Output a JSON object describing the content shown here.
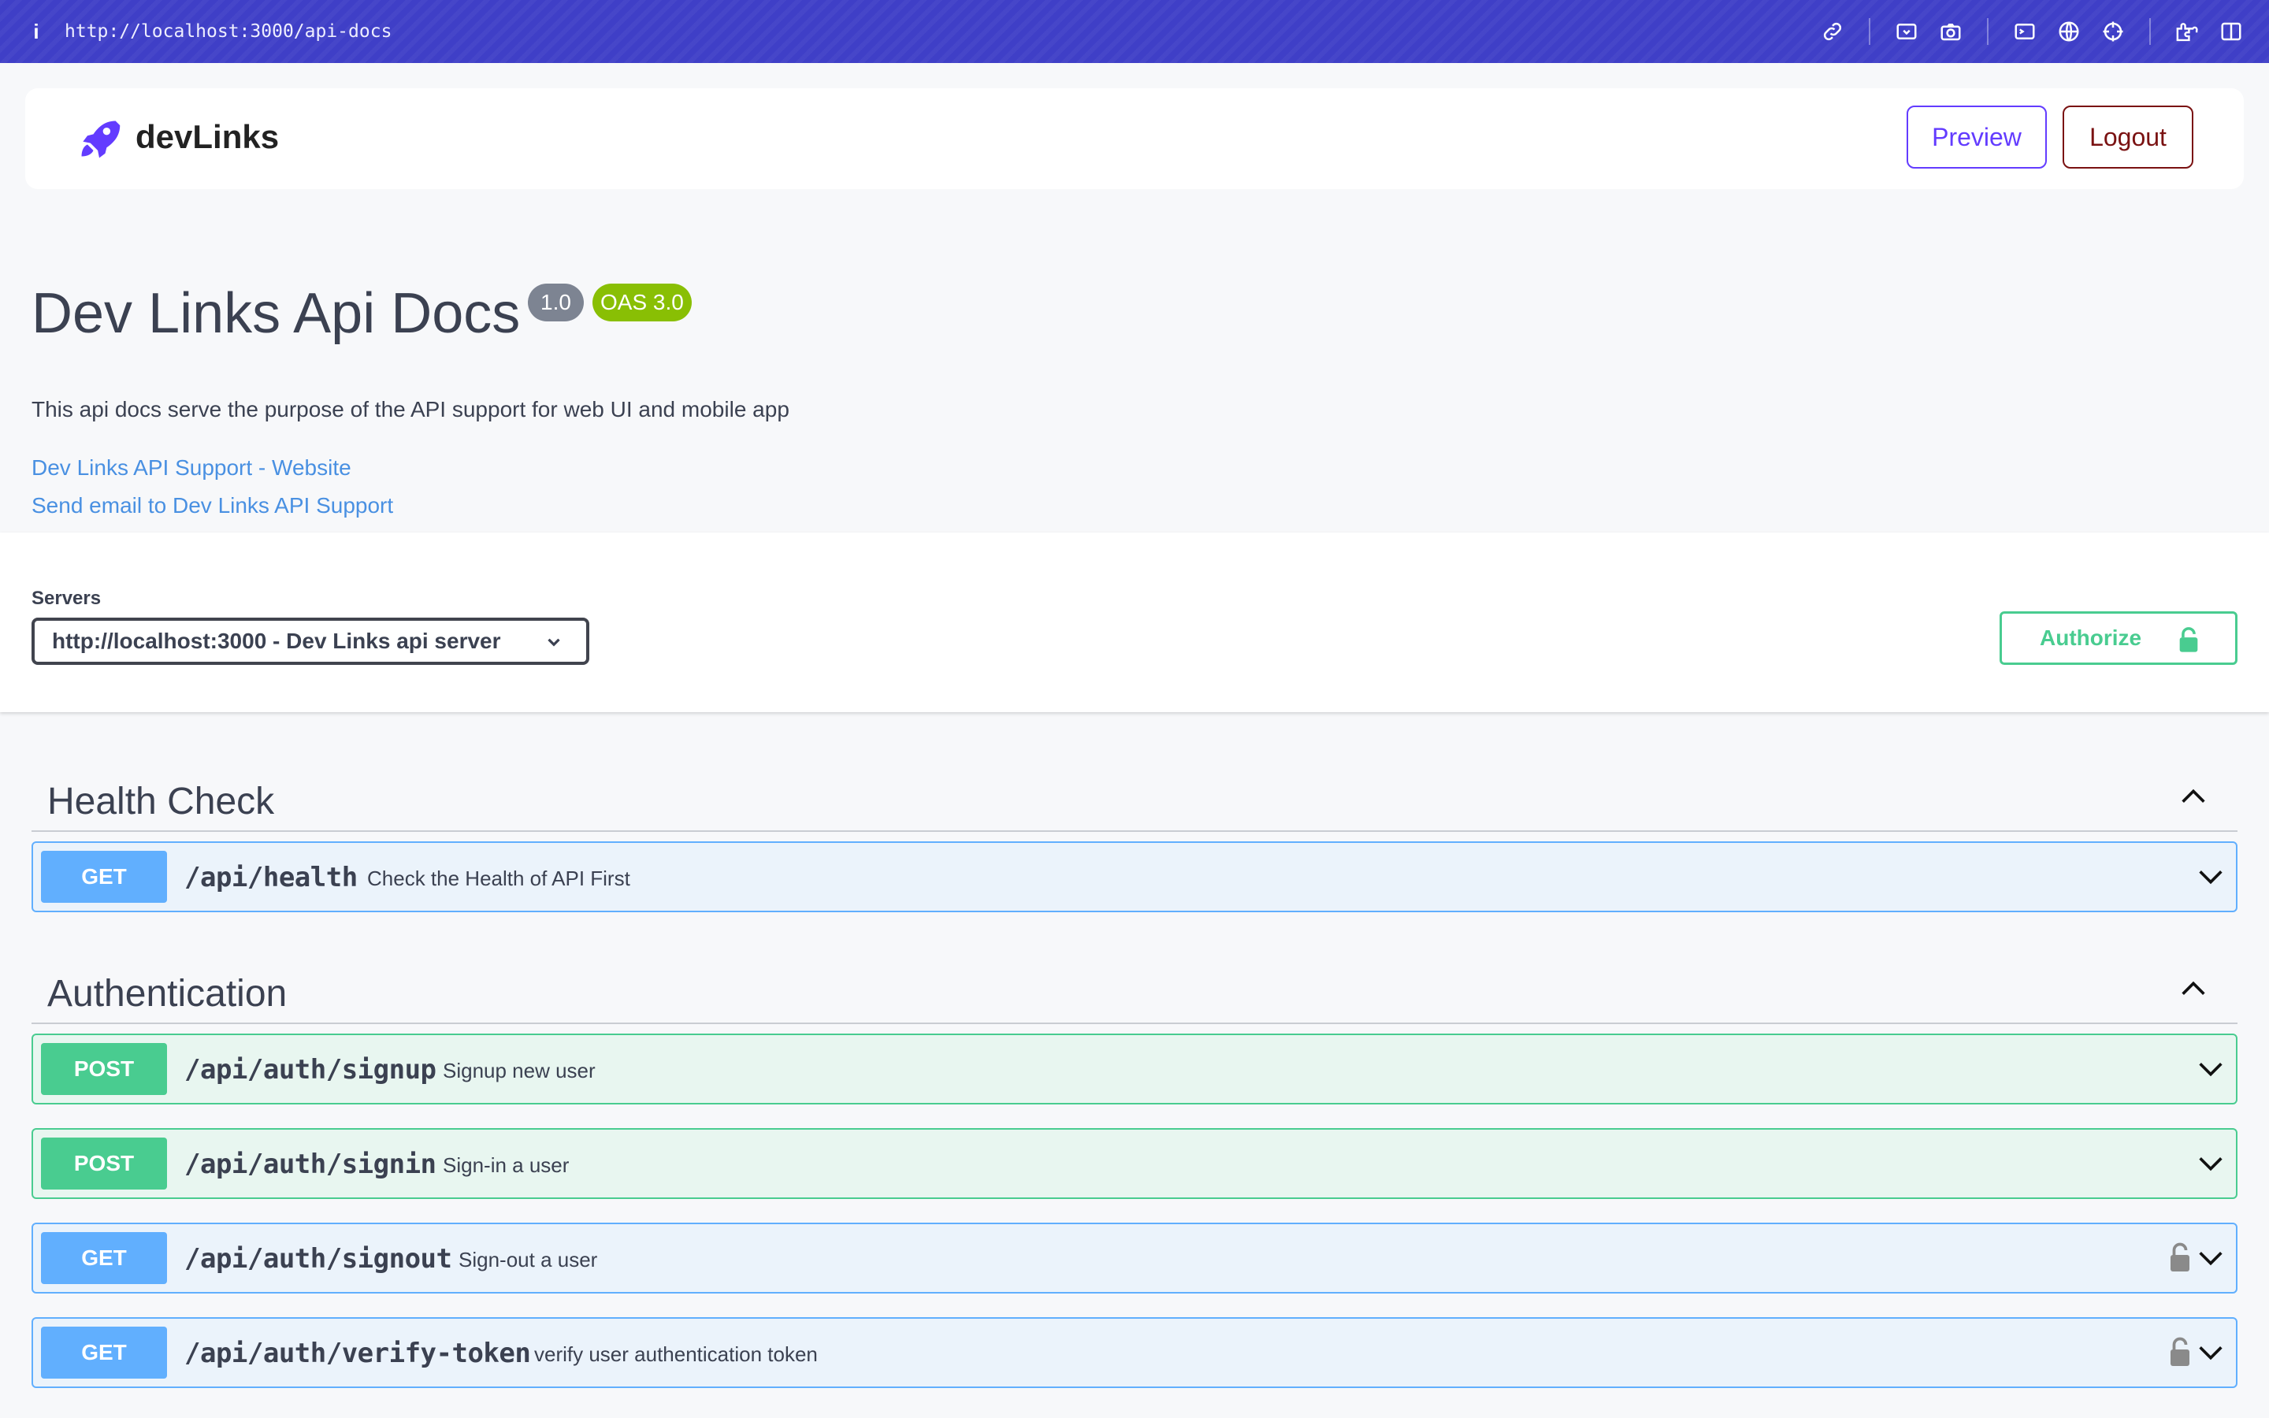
{
  "browser": {
    "info_glyph": "i",
    "url": "http://localhost:3000/api-docs"
  },
  "header": {
    "brand": "devLinks",
    "preview_label": "Preview",
    "logout_label": "Logout"
  },
  "info": {
    "title": "Dev Links Api Docs",
    "version": "1.0",
    "oas": "OAS 3.0",
    "description": "This api docs serve the purpose of the API support for web UI and mobile app",
    "website_link": "Dev Links API Support - Website",
    "email_link": "Send email to Dev Links API Support"
  },
  "servers": {
    "label": "Servers",
    "selected": "http://localhost:3000 - Dev Links api server"
  },
  "authorize_label": "Authorize",
  "tags": [
    {
      "name": "Health Check",
      "operations": [
        {
          "method": "GET",
          "path": "/api/health",
          "summary": "Check the Health of API First",
          "locked": false
        }
      ]
    },
    {
      "name": "Authentication",
      "operations": [
        {
          "method": "POST",
          "path": "/api/auth/signup",
          "summary": "Signup new user",
          "locked": false
        },
        {
          "method": "POST",
          "path": "/api/auth/signin",
          "summary": "Sign-in a user",
          "locked": false
        },
        {
          "method": "GET",
          "path": "/api/auth/signout",
          "summary": "Sign-out a user",
          "locked": true
        },
        {
          "method": "GET",
          "path": "/api/auth/verify-token",
          "summary": "verify user authentication token",
          "locked": true
        }
      ]
    }
  ],
  "colors": {
    "browser_bar": "#3f3fc7",
    "brand_purple": "#633cff",
    "logout_red": "#7a1212",
    "get_blue": "#61affe",
    "post_green": "#49cc90",
    "oas_green": "#89bf04",
    "link_blue": "#4990e2"
  }
}
